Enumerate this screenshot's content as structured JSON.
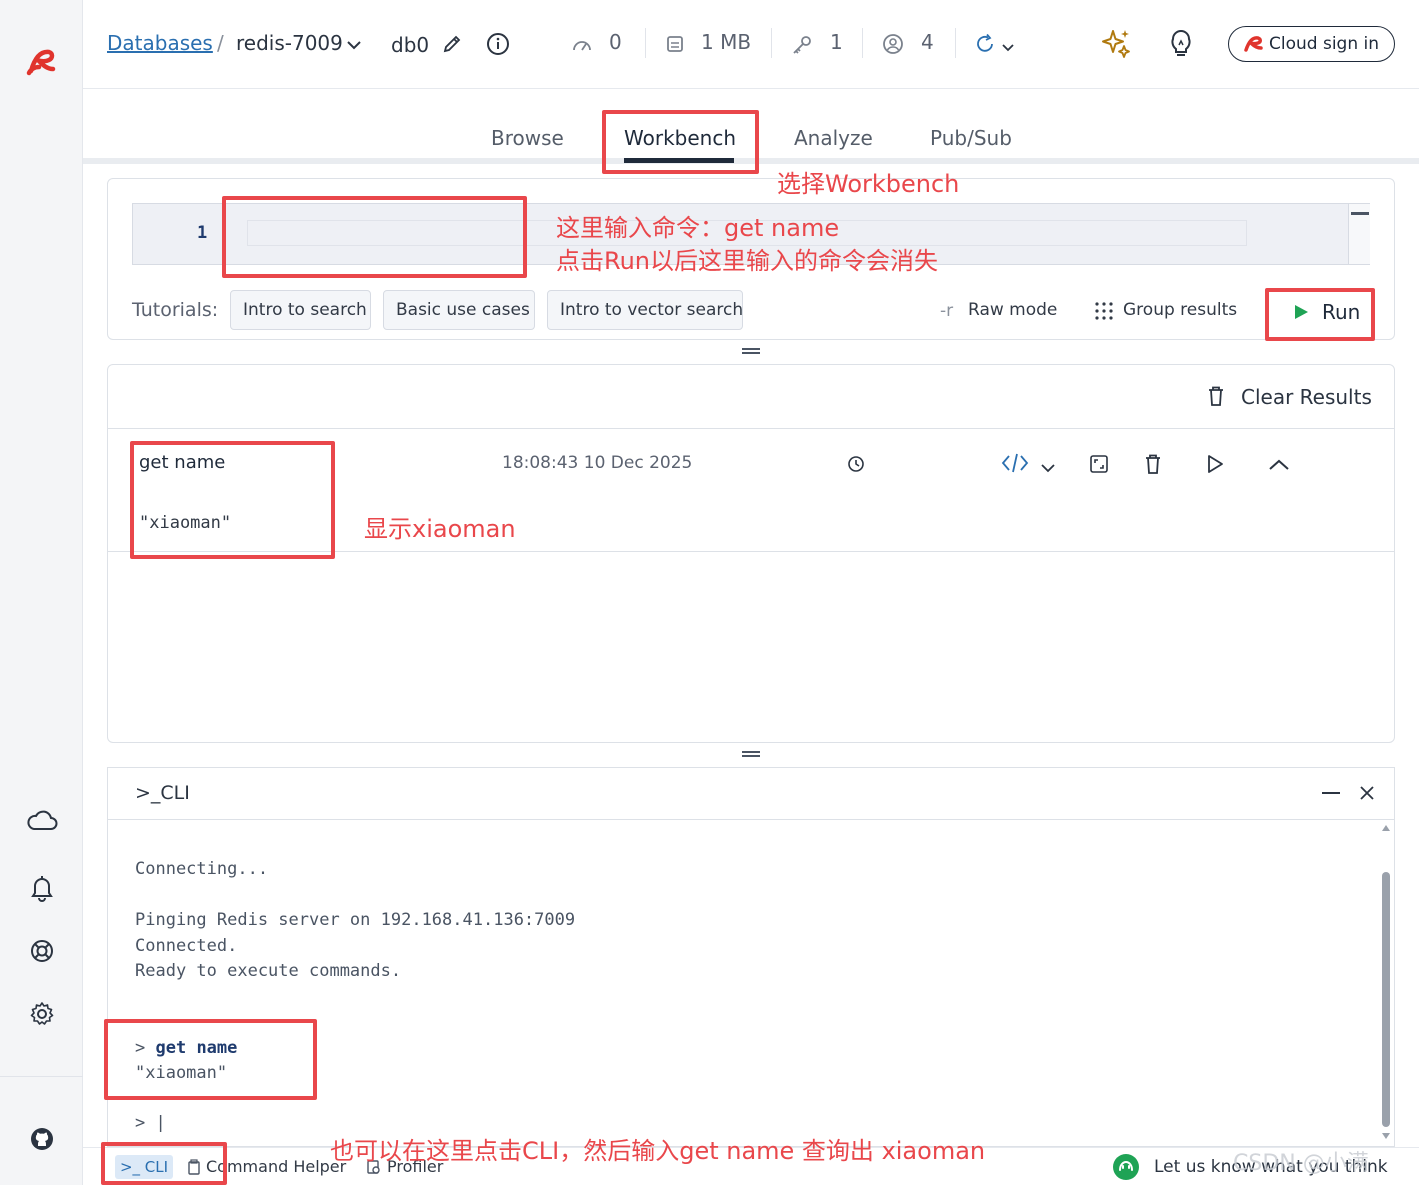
{
  "sidebar": {
    "logo": "redis-logo-icon",
    "icons": [
      "cloud-icon",
      "bell-icon",
      "lifebuoy-icon",
      "gear-icon",
      "github-icon"
    ]
  },
  "header": {
    "breadcrumb_link": "Databases",
    "breadcrumb_sep": "/",
    "db_name": "redis-7009",
    "db_index": "db0",
    "stats": {
      "cpu": "0",
      "memory": "1 MB",
      "keys": "1",
      "clients": "4"
    },
    "cloud_button": "Cloud sign in"
  },
  "tabs": [
    {
      "label": "Browse"
    },
    {
      "label": "Workbench",
      "active": true
    },
    {
      "label": "Analyze"
    },
    {
      "label": "Pub/Sub"
    }
  ],
  "editor": {
    "line_number": "1",
    "value": ""
  },
  "tutorials": {
    "label": "Tutorials:",
    "buttons": [
      "Intro to search",
      "Basic use cases",
      "Intro to vector search"
    ]
  },
  "toolbar": {
    "raw_mode_glyph": "-r",
    "raw_mode": "Raw mode",
    "group_results": "Group results",
    "run": "Run"
  },
  "results": {
    "clear_label": "Clear Results",
    "items": [
      {
        "command": "get name",
        "timestamp": "18:08:43 10 Dec 2025",
        "output": "\"xiaoman\""
      }
    ]
  },
  "cli": {
    "title": ">_CLI",
    "lines": [
      "Connecting...",
      "Pinging Redis server on 192.168.41.136:7009",
      "Connected.",
      "Ready to execute commands."
    ],
    "prompt": ">",
    "last_command": "get name",
    "last_output": "\"xiaoman\"",
    "input_prompt": "> |"
  },
  "bottombar": {
    "cli": ">_ CLI",
    "command_helper": "Command Helper",
    "profiler": "Profiler",
    "feedback": "Let us know what you think",
    "watermark": "CSDN @小满"
  },
  "annotations": {
    "workbench": "选择Workbench",
    "editor_line1": "这里输入命令：get name",
    "editor_line2": "点击Run以后这里输入的命令会消失",
    "result": "显示xiaoman",
    "cli": "也可以在这里点击CLI，然后输入get name 查询出 xiaoman"
  },
  "colors": {
    "accent_red": "#e9474b",
    "run_green": "#1fa355",
    "redis_red": "#e0342d",
    "link_blue": "#2a6fb0"
  }
}
